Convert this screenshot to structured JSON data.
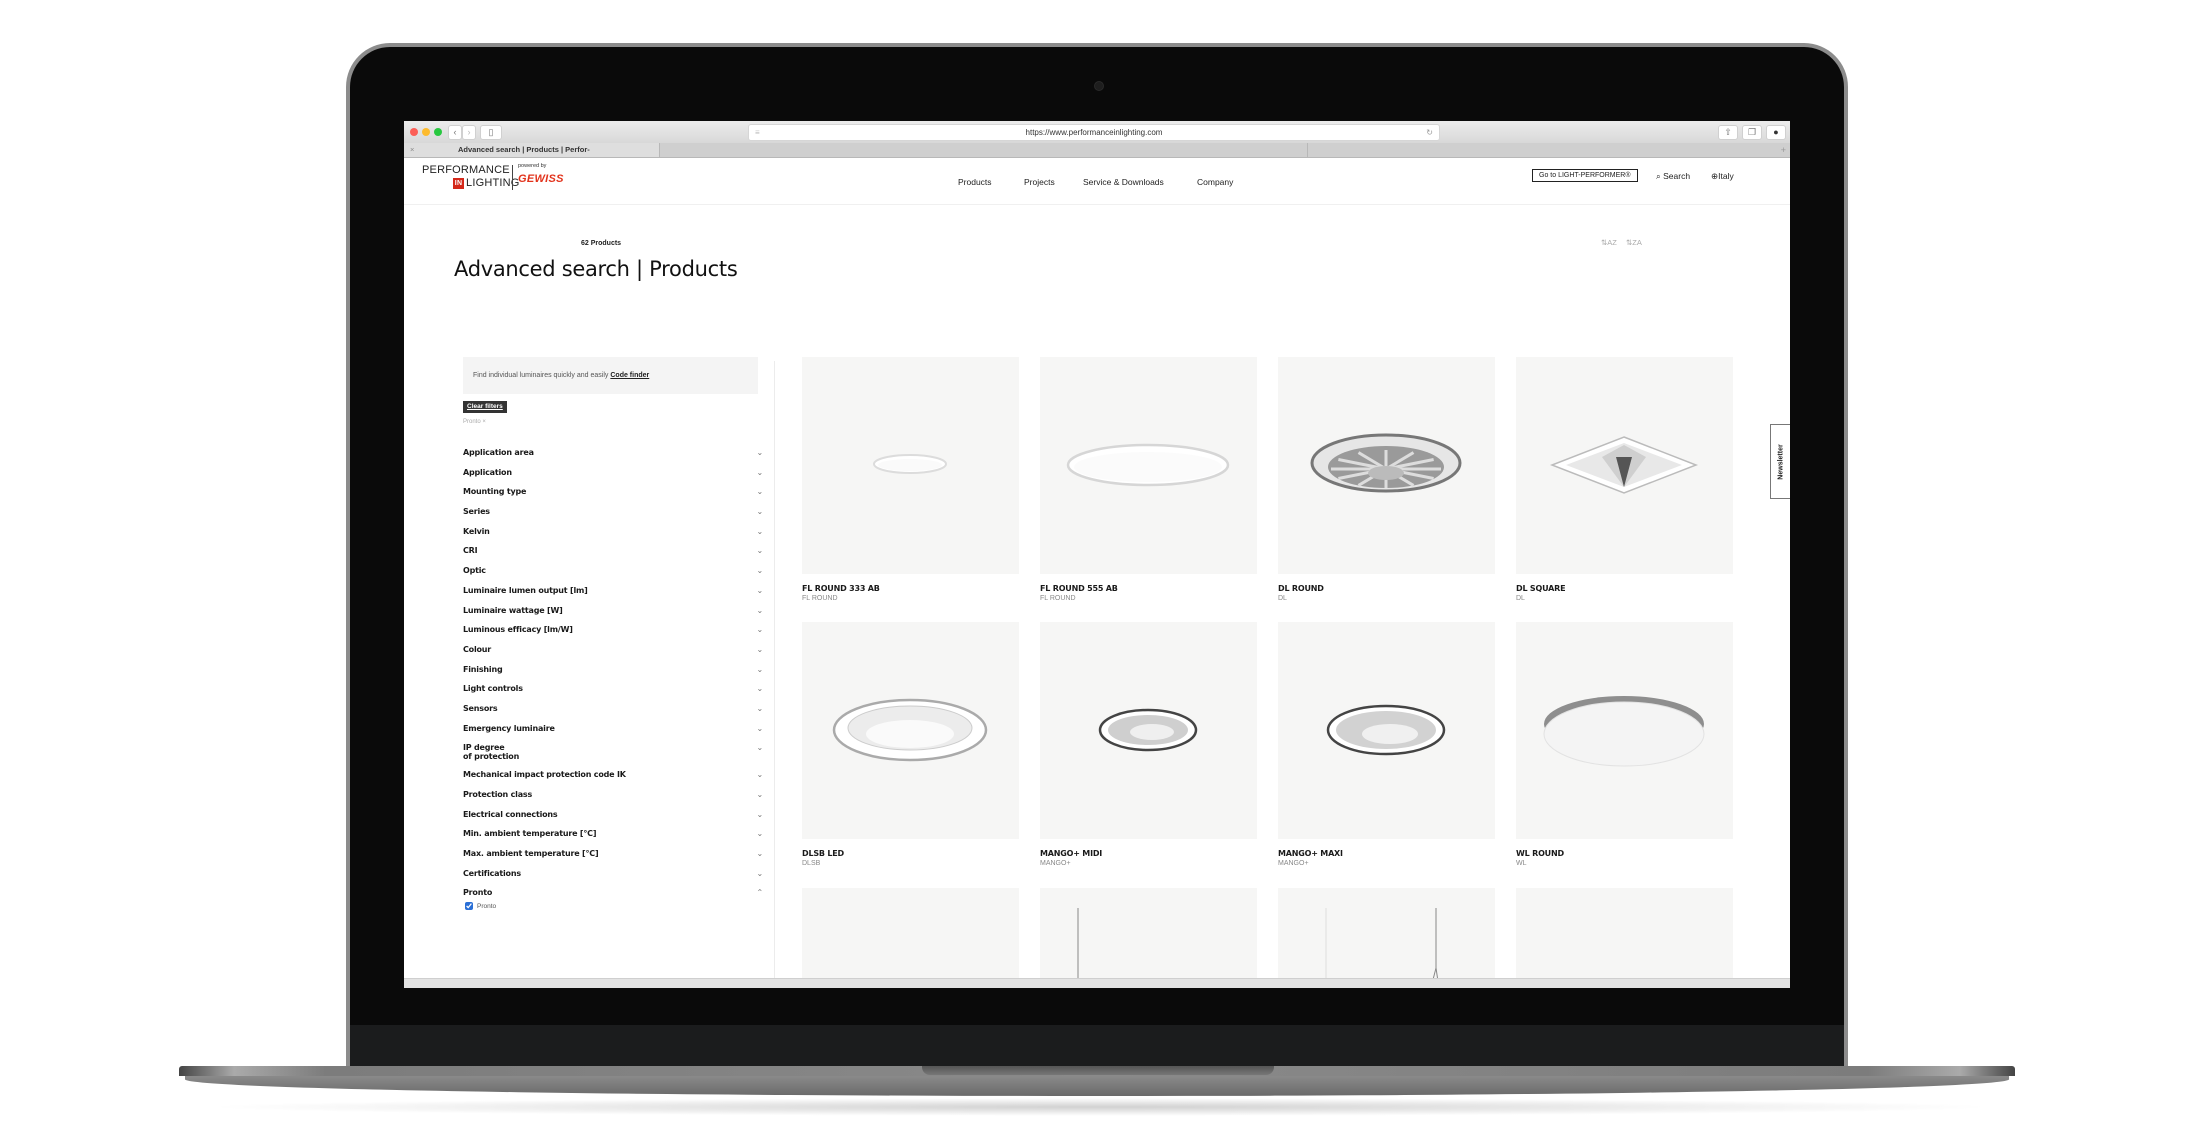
{
  "browser": {
    "url": "https://www.performanceinlighting.com",
    "tab_title": "Advanced search | Products | Perfor-",
    "tab_close": "×",
    "new_tab": "+"
  },
  "header": {
    "logo_line1": "PERFORMANCE",
    "logo_in": "IN",
    "logo_line2": "LIGHTING",
    "powered_by": "powered by",
    "brand": "GEWISS",
    "nav": [
      "Products",
      "Projects",
      "Service & Downloads",
      "Company"
    ],
    "cta": "Go to LIGHT-PERFORMER®",
    "search": "Search",
    "country": "Italy"
  },
  "page": {
    "title": "Advanced search | Products",
    "info_text": "Find individual luminaires quickly and easily",
    "info_link": "Code finder",
    "clear_filters": "Clear filters",
    "active_filter_chip": "Pronto ×",
    "product_count": "62 Products",
    "sort_az": "AZ",
    "sort_za": "ZA",
    "newsletter": "Newsletter"
  },
  "filters": [
    {
      "label": "Application area",
      "expanded": false
    },
    {
      "label": "Application",
      "expanded": false
    },
    {
      "label": "Mounting type",
      "expanded": false
    },
    {
      "label": "Series",
      "expanded": false
    },
    {
      "label": "Kelvin",
      "expanded": false
    },
    {
      "label": "CRI",
      "expanded": false
    },
    {
      "label": "Optic",
      "expanded": false
    },
    {
      "label": "Luminaire lumen output [lm]",
      "expanded": false
    },
    {
      "label": "Luminaire wattage [W]",
      "expanded": false
    },
    {
      "label": "Luminous efficacy [lm/W]",
      "expanded": false
    },
    {
      "label": "Colour",
      "expanded": false
    },
    {
      "label": "Finishing",
      "expanded": false
    },
    {
      "label": "Light controls",
      "expanded": false
    },
    {
      "label": "Sensors",
      "expanded": false
    },
    {
      "label": "Emergency luminaire",
      "expanded": false
    },
    {
      "label": "IP degree\nof protection",
      "expanded": false
    },
    {
      "label": "Mechanical impact protection code IK",
      "expanded": false
    },
    {
      "label": "Protection class",
      "expanded": false
    },
    {
      "label": "Electrical connections",
      "expanded": false
    },
    {
      "label": "Min. ambient temperature [°C]",
      "expanded": false
    },
    {
      "label": "Max. ambient temperature [°C]",
      "expanded": false
    },
    {
      "label": "Certifications",
      "expanded": false
    },
    {
      "label": "Pronto",
      "expanded": true,
      "options": [
        {
          "label": "Pronto",
          "checked": true
        }
      ]
    }
  ],
  "products": [
    {
      "name": "FL ROUND 333 AB",
      "series": "FL ROUND",
      "shape": "thin-disc-small"
    },
    {
      "name": "FL ROUND 555 AB",
      "series": "FL ROUND",
      "shape": "thin-disc-large"
    },
    {
      "name": "DL ROUND",
      "series": "DL",
      "shape": "reflector-ribbed"
    },
    {
      "name": "DL SQUARE",
      "series": "DL",
      "shape": "square-recessed"
    },
    {
      "name": "DLSB LED",
      "series": "DLSB",
      "shape": "downlight-wide"
    },
    {
      "name": "MANGO+ MIDI",
      "series": "MANGO+",
      "shape": "downlight-small"
    },
    {
      "name": "MANGO+ MAXI",
      "series": "MANGO+",
      "shape": "downlight-medium"
    },
    {
      "name": "WL ROUND",
      "series": "WL",
      "shape": "surface-disc"
    },
    {
      "name": "",
      "series": "",
      "shape": "panel-linear"
    },
    {
      "name": "",
      "series": "",
      "shape": "suspended-linear"
    },
    {
      "name": "",
      "series": "",
      "shape": "suspended-square"
    },
    {
      "name": "",
      "series": "",
      "shape": "square-panel"
    }
  ]
}
